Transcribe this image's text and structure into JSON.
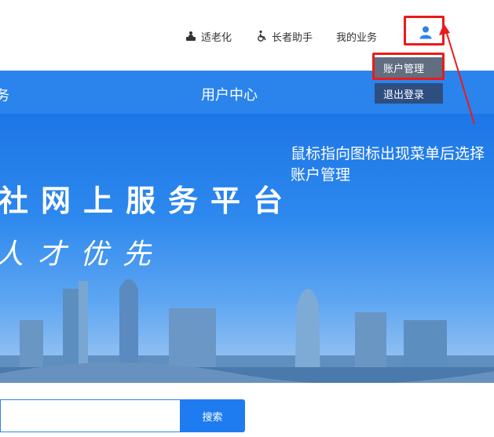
{
  "header": {
    "links": [
      {
        "label": "适老化",
        "icon": "elderly-care-icon"
      },
      {
        "label": "长者助手",
        "icon": "wheelchair-icon"
      },
      {
        "label": "我的业务",
        "icon": ""
      }
    ],
    "user_icon": "user-icon"
  },
  "nav": {
    "left_fragment": "务",
    "center_label": "用户中心"
  },
  "banner": {
    "title_fragment": "社网上服务平台",
    "slogan_fragment": "人才优先",
    "annotation": "鼠标指向图标出现菜单后选择账户管理"
  },
  "user_menu": {
    "items": [
      "账户管理",
      "退出登录"
    ]
  },
  "search": {
    "value": "",
    "placeholder": "",
    "button_label": "搜索"
  },
  "colors": {
    "primary_blue": "#2a84ec",
    "highlight_red": "#ec1a1a",
    "menu_item_active": "#606e80",
    "menu_item": "#2e4e80"
  }
}
